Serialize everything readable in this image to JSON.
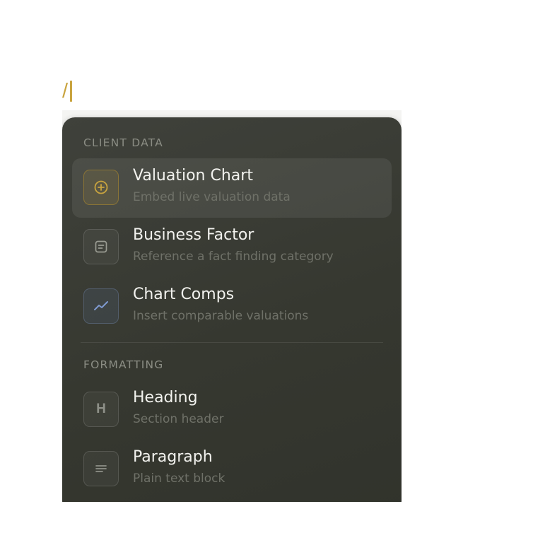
{
  "editor": {
    "slash_text": "/"
  },
  "menu": {
    "sections": [
      {
        "label": "CLIENT DATA",
        "items": [
          {
            "title": "Valuation Chart",
            "subtitle": "Embed live valuation data",
            "icon": "plus-circle-icon",
            "active": true
          },
          {
            "title": "Business Factor",
            "subtitle": "Reference a fact finding category",
            "icon": "document-icon"
          },
          {
            "title": "Chart Comps",
            "subtitle": "Insert comparable valuations",
            "icon": "trend-line-icon"
          }
        ]
      },
      {
        "label": "FORMATTING",
        "items": [
          {
            "title": "Heading",
            "subtitle": "Section header",
            "icon": "heading-icon",
            "glyph": "H"
          },
          {
            "title": "Paragraph",
            "subtitle": "Plain text block",
            "icon": "paragraph-lines-icon"
          }
        ]
      }
    ]
  },
  "colors": {
    "accent_gold": "#c9a43f",
    "menu_bg": "#373930",
    "chart_icon_blue": "#7f9ad0"
  }
}
